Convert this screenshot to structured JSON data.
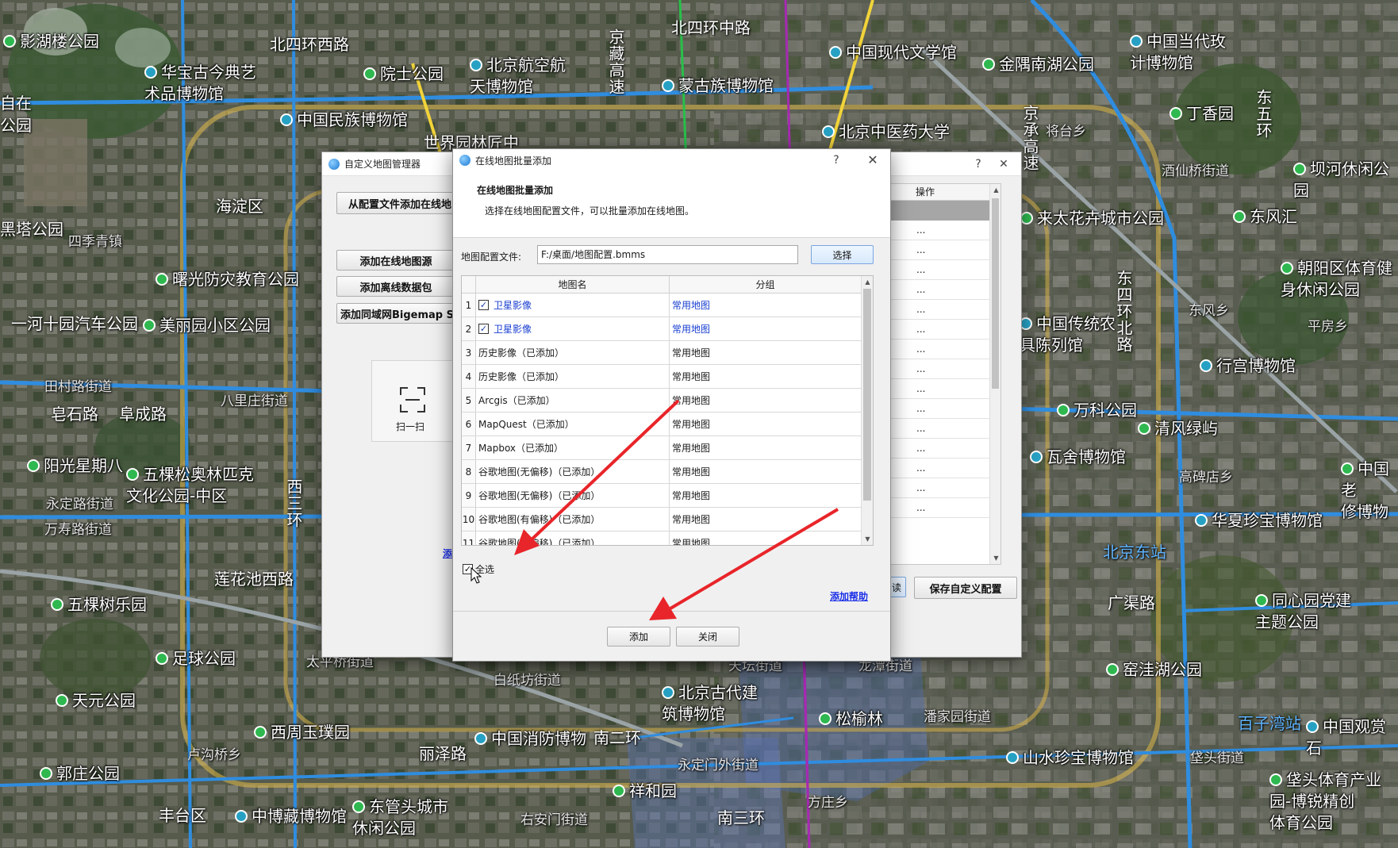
{
  "map": {
    "pois": [
      {
        "text": "影湖楼公园",
        "icon": "park"
      },
      {
        "text": "华宝古今典艺\n术品博物馆",
        "icon": "museum"
      },
      {
        "text": "院士公园",
        "icon": "park"
      },
      {
        "text": "北京航空航\n天博物馆",
        "icon": "museum"
      },
      {
        "text": "蒙古族博物馆",
        "icon": "museum"
      },
      {
        "text": "中国现代文学馆",
        "icon": "museum"
      },
      {
        "text": "金隅南湖公园",
        "icon": "park"
      },
      {
        "text": "中国当代玫\n计博物馆",
        "icon": "museum"
      },
      {
        "text": "丁香园",
        "icon": "park"
      },
      {
        "text": "中国民族博物馆",
        "icon": "museum"
      },
      {
        "text": "北京中医药大学",
        "icon": "museum"
      },
      {
        "text": "坝河休闲公园",
        "icon": "park"
      },
      {
        "text": "来太花卉城市公园",
        "icon": "park"
      },
      {
        "text": "东风汇",
        "icon": "park"
      },
      {
        "text": "朝阳区体育健\n身休闲公园",
        "icon": "park"
      },
      {
        "text": "曙光防灾教育公园",
        "icon": "park"
      },
      {
        "text": "美丽园小区公园",
        "icon": "park"
      },
      {
        "text": "中国传统农\n具陈列馆",
        "icon": "museum"
      },
      {
        "text": "行宫博物馆",
        "icon": "museum"
      },
      {
        "text": "万科公园",
        "icon": "park"
      },
      {
        "text": "清风绿屿",
        "icon": "park"
      },
      {
        "text": "瓦舍博物馆",
        "icon": "museum"
      },
      {
        "text": "阳光星期八",
        "icon": "park"
      },
      {
        "text": "五棵松奥林匹克\n文化公园-中区",
        "icon": "park"
      },
      {
        "text": "中国老\n修博物",
        "icon": "park"
      },
      {
        "text": "华夏珍宝博物馆",
        "icon": "museum"
      },
      {
        "text": "五棵树乐园",
        "icon": "park"
      },
      {
        "text": "同心园党建\n主题公园",
        "icon": "park"
      },
      {
        "text": "足球公园",
        "icon": "park"
      },
      {
        "text": "窑洼湖公园",
        "icon": "park"
      },
      {
        "text": "天元公园",
        "icon": "park"
      },
      {
        "text": "北京古代建\n筑博物馆",
        "icon": "museum"
      },
      {
        "text": "松榆林",
        "icon": "park"
      },
      {
        "text": "西周玉璞园",
        "icon": "park"
      },
      {
        "text": "中国消防博物",
        "icon": "museum"
      },
      {
        "text": "山水珍宝博物馆",
        "icon": "museum"
      },
      {
        "text": "中国观赏石",
        "icon": "museum"
      },
      {
        "text": "郭庄公园",
        "icon": "park"
      },
      {
        "text": "祥和园",
        "icon": "park"
      },
      {
        "text": "垡头体育产业\n园-博锐精创\n体育公园",
        "icon": "park"
      },
      {
        "text": "中博藏博物馆",
        "icon": "museum"
      },
      {
        "text": "东管头城市\n休闲公园",
        "icon": "park"
      }
    ],
    "roads": [
      {
        "text": "北四环西路",
        "size": "lg"
      },
      {
        "text": "北四环中路",
        "size": "lg"
      },
      {
        "text": "海淀区",
        "size": "lg"
      },
      {
        "text": "四季青镇",
        "size": "sm"
      },
      {
        "text": "黑塔公园",
        "size": "lg"
      },
      {
        "text": "自在\n公园",
        "size": "lg"
      },
      {
        "text": "一河十园汽车公园",
        "size": "lg"
      },
      {
        "text": "田村路街道",
        "size": "sm"
      },
      {
        "text": "皂石路",
        "size": "lg"
      },
      {
        "text": "阜成路",
        "size": "lg"
      },
      {
        "text": "八里庄街道",
        "size": "sm"
      },
      {
        "text": "永定路街道",
        "size": "sm"
      },
      {
        "text": "万寿路街道",
        "size": "sm"
      },
      {
        "text": "莲花池西路",
        "size": "lg"
      },
      {
        "text": "西三环",
        "size": "lg"
      },
      {
        "text": "太平桥街道",
        "size": "sm"
      },
      {
        "text": "白纸坊街道",
        "size": "sm"
      },
      {
        "text": "天坛街道",
        "size": "sm"
      },
      {
        "text": "龙潭街道",
        "size": "sm"
      },
      {
        "text": "潘家园街道",
        "size": "sm"
      },
      {
        "text": "南二环",
        "size": "lg"
      },
      {
        "text": "永定门外街道",
        "size": "sm"
      },
      {
        "text": "卢沟桥乡",
        "size": "sm"
      },
      {
        "text": "丽泽路",
        "size": "lg"
      },
      {
        "text": "丰台区",
        "size": "lg"
      },
      {
        "text": "右安门街道",
        "size": "sm"
      },
      {
        "text": "南三环",
        "size": "lg"
      },
      {
        "text": "方庄乡",
        "size": "sm"
      },
      {
        "text": "东四环北路",
        "size": "lg"
      },
      {
        "text": "东风乡",
        "size": "sm"
      },
      {
        "text": "平房乡",
        "size": "sm"
      },
      {
        "text": "高碑店乡",
        "size": "sm"
      },
      {
        "text": "广渠路",
        "size": "lg"
      },
      {
        "text": "北京东站",
        "size": "station"
      },
      {
        "text": "百子湾站",
        "size": "station"
      },
      {
        "text": "垡头街道",
        "size": "sm"
      },
      {
        "text": "酒仙桥街道",
        "size": "sm"
      },
      {
        "text": "将台乡",
        "size": "sm"
      },
      {
        "text": "东五环",
        "size": "lg"
      },
      {
        "text": "京承高速",
        "size": "lg"
      },
      {
        "text": "京藏高速",
        "size": "lg"
      },
      {
        "text": "世界园林匠中",
        "size": "lg"
      }
    ]
  },
  "back_dialog": {
    "title": "自定义地图管理器",
    "help_btn": "?",
    "close_btn": "✕",
    "btn_add_from_config": "从配置文件添加在线地",
    "btn_add_online": "添加在线地图源",
    "btn_add_offline": "添加离线数据包",
    "btn_add_lan": "添加同域网Bigemap S",
    "scan_label": "扫一扫",
    "table_header_op": "操作",
    "row_op": "...",
    "partial_link": "添",
    "partial_btn": "读",
    "save_btn": "保存自定义配置",
    "op_rows": 15
  },
  "front_dialog": {
    "title": "在线地图批量添加",
    "help_btn": "?",
    "close_btn": "✕",
    "heading": "在线地图批量添加",
    "description": "选择在线地图配置文件，可以批量添加在线地图。",
    "file_label": "地图配置文件:",
    "file_value": "F:/桌面/地图配置.bmms",
    "choose_btn": "选择",
    "col_name": "地图名",
    "col_group": "分组",
    "rows": [
      {
        "no": "1",
        "name": "卫星影像",
        "group": "常用地图",
        "checked": true,
        "highlight": true
      },
      {
        "no": "2",
        "name": "卫星影像",
        "group": "常用地图",
        "checked": true,
        "highlight": true
      },
      {
        "no": "3",
        "name": "历史影像（已添加）",
        "group": "常用地图",
        "checked": false,
        "highlight": false
      },
      {
        "no": "4",
        "name": "历史影像（已添加）",
        "group": "常用地图",
        "checked": false,
        "highlight": false
      },
      {
        "no": "5",
        "name": "Arcgis（已添加）",
        "group": "常用地图",
        "checked": false,
        "highlight": false
      },
      {
        "no": "6",
        "name": "MapQuest（已添加）",
        "group": "常用地图",
        "checked": false,
        "highlight": false
      },
      {
        "no": "7",
        "name": "Mapbox（已添加）",
        "group": "常用地图",
        "checked": false,
        "highlight": false
      },
      {
        "no": "8",
        "name": "谷歌地图(无偏移)（已添加）",
        "group": "常用地图",
        "checked": false,
        "highlight": false
      },
      {
        "no": "9",
        "name": "谷歌地图(无偏移)（已添加）",
        "group": "常用地图",
        "checked": false,
        "highlight": false
      },
      {
        "no": "10",
        "name": "谷歌地图(有偏移)（已添加）",
        "group": "常用地图",
        "checked": false,
        "highlight": false
      },
      {
        "no": "11",
        "name": "谷歌地图(有偏移)（已添加）",
        "group": "常用地图",
        "checked": false,
        "highlight": false
      }
    ],
    "select_all_label": "全选",
    "select_all_checked": true,
    "help_link": "添加帮助",
    "add_btn": "添加",
    "close_dialog_btn": "关闭"
  },
  "colors": {
    "annotation_arrow": "#e8252a",
    "link_blue": "#1b2fe8",
    "highlight_text": "#1a3fd0"
  }
}
